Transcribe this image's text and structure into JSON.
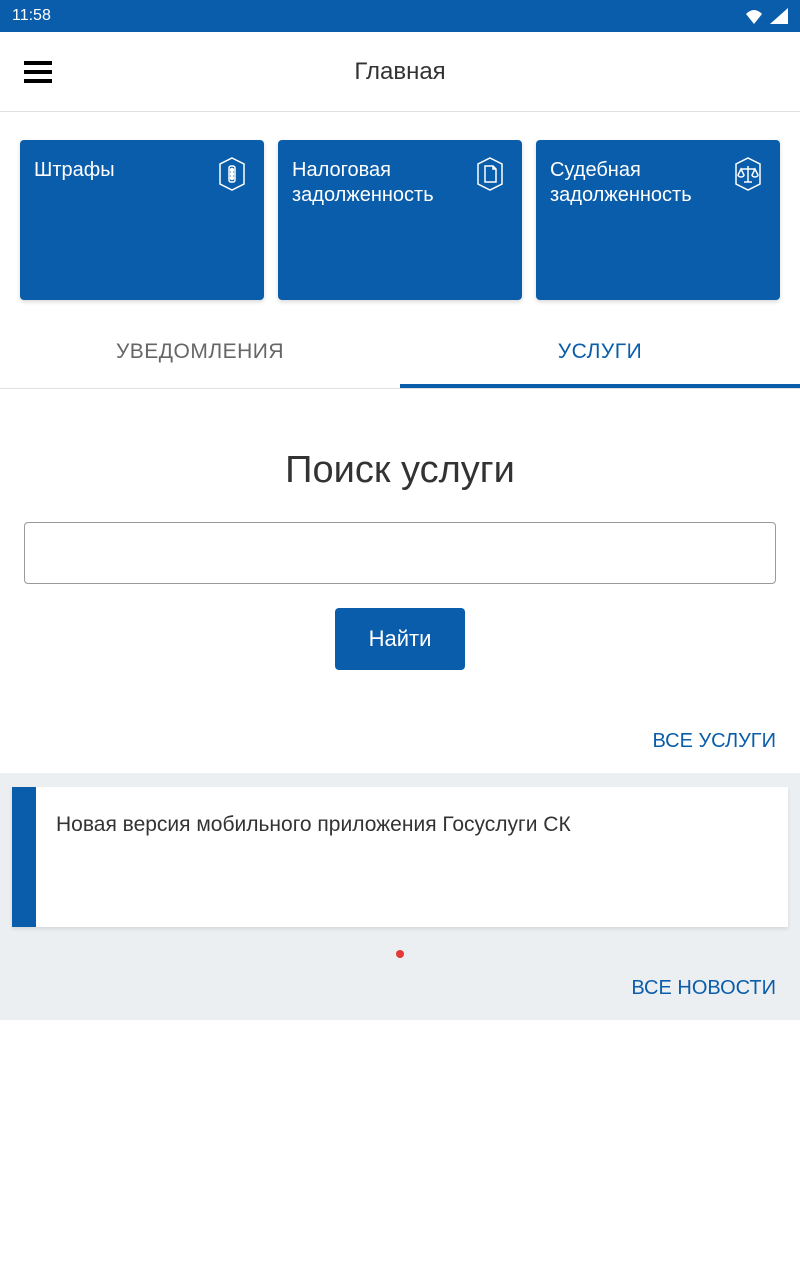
{
  "status": {
    "time": "11:58"
  },
  "header": {
    "title": "Главная"
  },
  "cards": [
    {
      "title": "Штрафы"
    },
    {
      "title": "Налоговая задолженность"
    },
    {
      "title": "Судебная задолженность"
    }
  ],
  "tabs": {
    "notifications": "УВЕДОМЛЕНИЯ",
    "services": "УСЛУГИ"
  },
  "search": {
    "heading": "Поиск услуги",
    "button": "Найти"
  },
  "links": {
    "allServices": "ВСЕ УСЛУГИ",
    "allNews": "ВСЕ НОВОСТИ"
  },
  "news": {
    "item": "Новая версия мобильного приложения Госуслуги СК"
  }
}
